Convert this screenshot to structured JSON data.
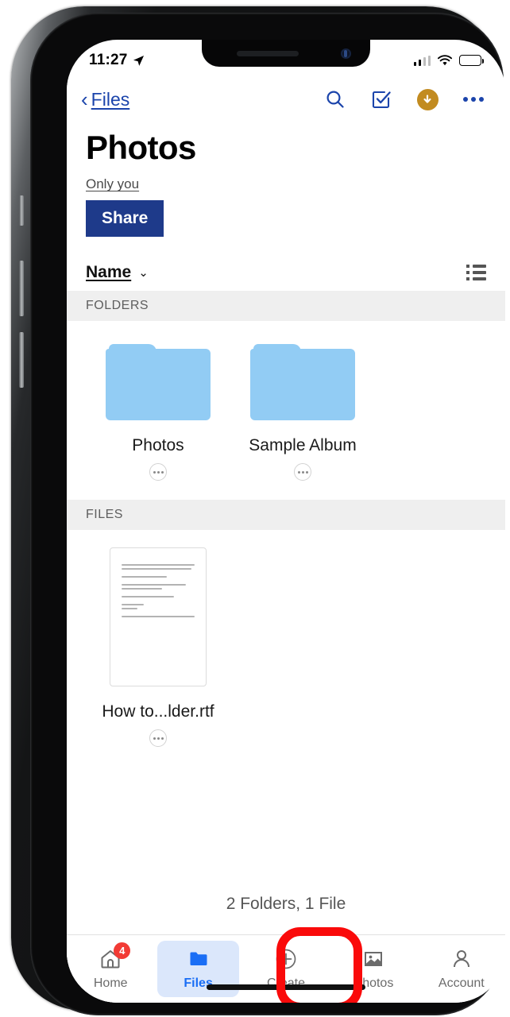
{
  "status_bar": {
    "time": "11:27",
    "location_icon": "location-arrow-icon",
    "signal_icon": "cellular-signal-icon",
    "wifi_icon": "wifi-icon",
    "battery_icon": "battery-full-icon"
  },
  "nav_bar": {
    "back_label": "Files",
    "back_chevron": "‹",
    "actions": [
      {
        "name": "search-icon",
        "label": "Search"
      },
      {
        "name": "select-checkbox-icon",
        "label": "Select"
      },
      {
        "name": "download-icon",
        "label": "Download"
      },
      {
        "name": "more-options-icon",
        "label": "More"
      }
    ],
    "colors": {
      "link": "#1b44ab",
      "download_badge": "#c28b20"
    }
  },
  "header": {
    "title": "Photos",
    "share_status": "Only you",
    "share_button": "Share",
    "share_button_color": "#1e3a8a"
  },
  "sort_bar": {
    "sort_label": "Name",
    "sort_chevron": "⌄",
    "view_toggle_icon": "list-view-icon"
  },
  "sections": [
    {
      "header": "FOLDERS",
      "items": [
        {
          "label": "Photos",
          "type": "folder",
          "more": "⋯"
        },
        {
          "label": "Sample Album",
          "type": "folder",
          "more": "⋯"
        }
      ]
    },
    {
      "header": "FILES",
      "items": [
        {
          "label": "How to...lder.rtf",
          "type": "document",
          "more": "⋯"
        }
      ]
    }
  ],
  "count_text": "2 Folders, 1 File",
  "tab_bar": {
    "tabs": [
      {
        "label": "Home",
        "icon": "home-icon",
        "active": false,
        "badge": "4"
      },
      {
        "label": "Files",
        "icon": "folder-icon",
        "active": true,
        "badge": ""
      },
      {
        "label": "Create",
        "icon": "plus-circle-icon",
        "active": false,
        "badge": ""
      },
      {
        "label": "Photos",
        "icon": "photo-icon",
        "active": false,
        "badge": ""
      },
      {
        "label": "Account",
        "icon": "person-icon",
        "active": false,
        "badge": ""
      }
    ],
    "active_color": "#1a6ef5",
    "badge_color": "#f23b35"
  },
  "annotation": {
    "target": "Create",
    "shape": "rounded-rectangle-outline",
    "color": "#fa0a0a"
  }
}
